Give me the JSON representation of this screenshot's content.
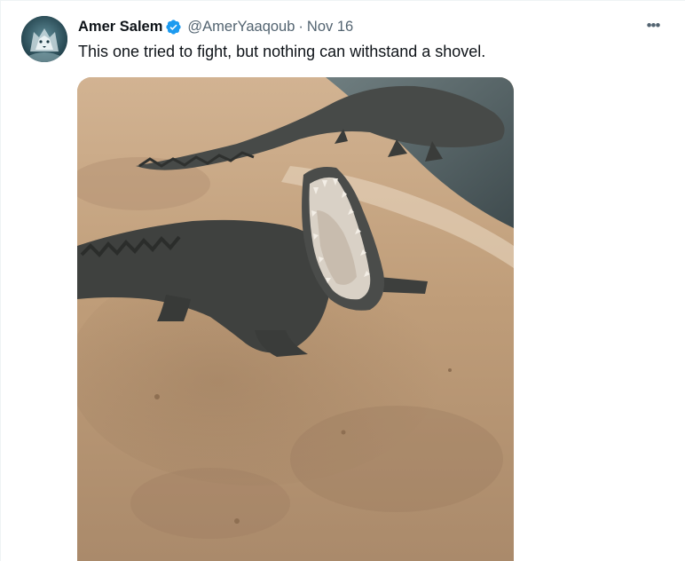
{
  "tweet": {
    "display_name": "Amer Salem",
    "handle": "@AmerYaaqoub",
    "separator": "·",
    "date": "Nov 16",
    "text": "This one tried to fight, but nothing can withstand a shovel.",
    "more_label": "•••"
  },
  "avatar": {
    "icon": "wolf-avatar"
  },
  "verified": {
    "icon": "verified-badge-icon",
    "color": "#1d9bf0"
  },
  "media": {
    "type": "video-still",
    "subject": "crocodiles on a sandy concrete ledge"
  },
  "colors": {
    "text_primary": "#0f1419",
    "text_secondary": "#536471",
    "accent": "#1d9bf0"
  }
}
